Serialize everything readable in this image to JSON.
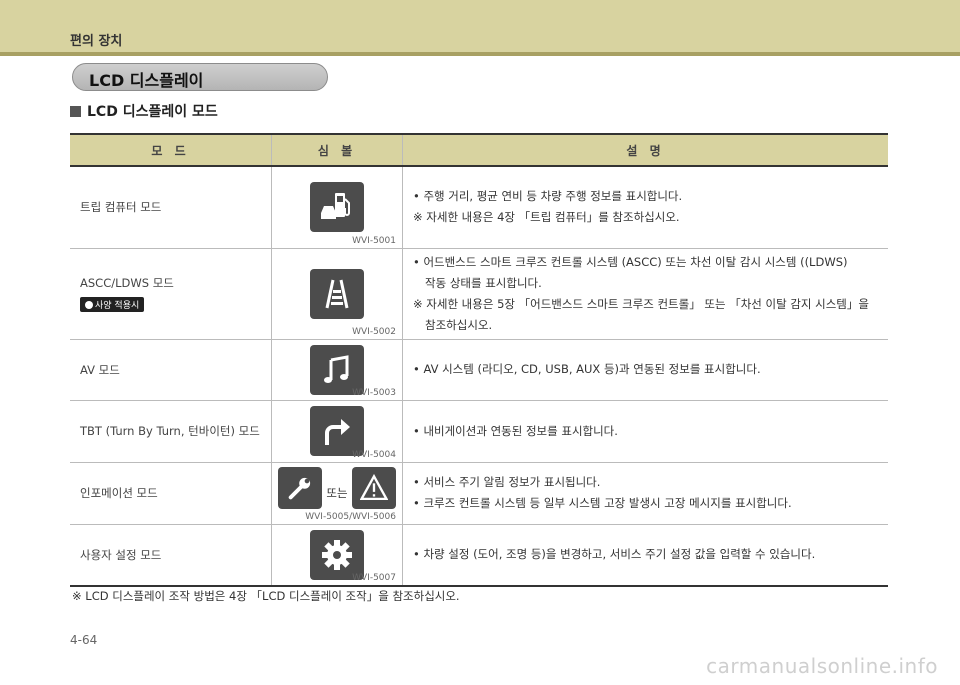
{
  "header": {
    "section": "편의 장치"
  },
  "title_pill": "LCD 디스플레이",
  "subheading": "LCD 디스플레이 모드",
  "table": {
    "headers": [
      "모 드",
      "심 볼",
      "설 명"
    ],
    "rows": [
      {
        "mode": "트립 컴퓨터 모드",
        "icon": "fuel-icon",
        "code": "WVI-5001",
        "desc": [
          "• 주행 거리, 평균 연비 등 차량 주행 정보를 표시합니다.",
          "※ 자세한 내용은 4장 「트립 컴퓨터」를 참조하십시오."
        ]
      },
      {
        "mode": "ASCC/LDWS 모드",
        "badge": "사양 적용시",
        "icon": "lane-icon",
        "code": "WVI-5002",
        "desc": [
          "• 어드밴스드 스마트 크루즈 컨트롤 시스템 (ASCC) 또는 차선 이탈 감시 시스템 ((LDWS)",
          "작동 상태를 표시합니다.",
          "※ 자세한 내용은 5장 「어드밴스드 스마트 크루즈 컨트롤」 또는 「차선 이탈 감지 시스템」을",
          "참조하십시오."
        ]
      },
      {
        "mode": "AV 모드",
        "icon": "music-note-icon",
        "code": "WVI-5003",
        "desc": [
          "• AV 시스템 (라디오, CD, USB, AUX 등)과 연동된 정보를 표시합니다."
        ]
      },
      {
        "mode": "TBT (Turn By Turn, 턴바이턴) 모드",
        "icon": "turn-arrow-icon",
        "code": "WVI-5004",
        "desc": [
          "• 내비게이션과 연동된 정보를 표시합니다."
        ]
      },
      {
        "mode": "인포메이션 모드",
        "icon": "wrench-icon",
        "icon2": "warning-icon",
        "or": "또는",
        "code": "WVI-5005/WVI-5006",
        "desc": [
          "• 서비스 주기 알림 정보가 표시됩니다.",
          "• 크루즈 컨트롤 시스템 등 일부 시스템 고장 발생시 고장 메시지를 표시합니다."
        ]
      },
      {
        "mode": "사용자 설정 모드",
        "icon": "gear-icon",
        "code": "WVI-5007",
        "desc": [
          "• 차량 설정 (도어, 조명 등)을 변경하고, 서비스 주기 설정 값을 입력할 수 있습니다."
        ]
      }
    ]
  },
  "footnote": "※ LCD 디스플레이 조작 방법은 4장 「LCD 디스플레이 조작」을 참조하십시오.",
  "page_number": "4-64",
  "watermark": "carmanualsonline.info"
}
